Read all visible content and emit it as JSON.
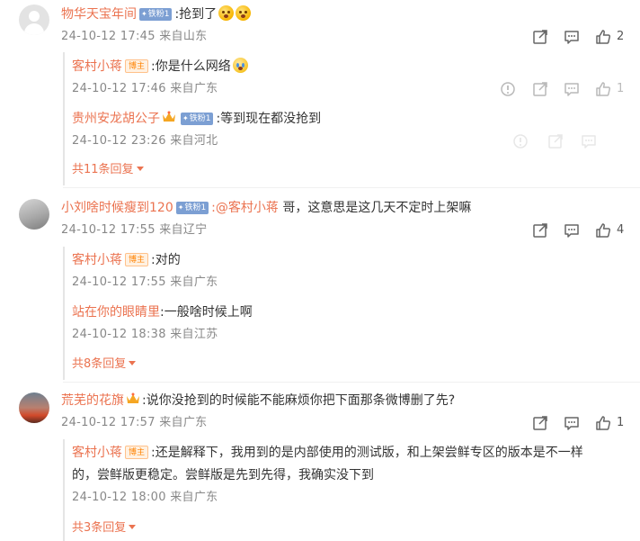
{
  "comments": [
    {
      "user": "物华天宝年间",
      "badge": "铁粉1",
      "text": ":抢到了",
      "meta": "24-10-12 17:45 来自山东",
      "likes": "2",
      "replies": [
        {
          "user": "客村小蒋",
          "badge": "博主",
          "text": ":你是什么网络",
          "meta": "24-10-12 17:46 来自广东",
          "likes": "1"
        },
        {
          "user": "贵州安龙胡公子",
          "badge": "铁粉1",
          "text": ":等到现在都没抢到",
          "meta": "24-10-12 23:26 来自河北",
          "likes": ""
        }
      ],
      "more_label": "共11条回复"
    },
    {
      "user": "小刘啥时候瘦到120",
      "badge": "铁粉1",
      "mention": ":@客村小蒋",
      "text": " 哥，这意思是这几天不定时上架嘛",
      "meta": "24-10-12 17:55 来自辽宁",
      "likes": "4",
      "replies": [
        {
          "user": "客村小蒋",
          "badge": "博主",
          "text": ":对的",
          "meta": "24-10-12 17:55 来自广东"
        },
        {
          "user": "站在你的眼睛里",
          "text": ":一般啥时候上啊",
          "meta": "24-10-12 18:38 来自江苏"
        }
      ],
      "more_label": "共8条回复"
    },
    {
      "user": "荒芜的花旗",
      "text": ":说你没抢到的时候能不能麻烦你把下面那条微博删了先?",
      "meta": "24-10-12 17:57 来自广东",
      "likes": "1",
      "replies": [
        {
          "user": "客村小蒋",
          "badge": "博主",
          "text_line1": ":还是解释下，我用到的是内部使用的测试版，和上架尝鲜专区的版本是不一样",
          "text_line2": "的，尝鲜版更稳定。尝鲜版是先到先得，我确实没下到",
          "meta": "24-10-12 18:00 来自广东"
        }
      ],
      "more_label": "共3条回复"
    }
  ],
  "icons": {
    "share": "share-icon",
    "comment": "comment-icon",
    "like": "like-icon",
    "report": "report-icon"
  },
  "colors": {
    "username": "#eb7350",
    "meta": "#888888",
    "fan_badge": "#7c9fd3",
    "host_badge": "#ff8200"
  }
}
